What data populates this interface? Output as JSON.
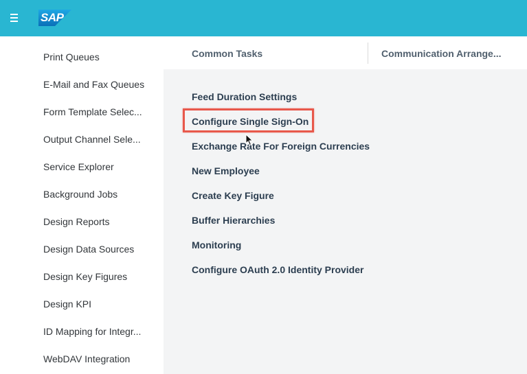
{
  "header": {
    "menu_icon": "hamburger-menu-icon",
    "logo_text": "SAP",
    "brand_color": "#29b6d2"
  },
  "sidebar": {
    "items": [
      {
        "label": "Print Queues"
      },
      {
        "label": "E-Mail and Fax Queues"
      },
      {
        "label": "Form Template Selec..."
      },
      {
        "label": "Output Channel Sele..."
      },
      {
        "label": "Service Explorer"
      },
      {
        "label": "Background Jobs"
      },
      {
        "label": "Design Reports"
      },
      {
        "label": "Design Data Sources"
      },
      {
        "label": "Design Key Figures"
      },
      {
        "label": "Design KPI"
      },
      {
        "label": "ID Mapping for Integr..."
      },
      {
        "label": "WebDAV Integration"
      }
    ]
  },
  "tabs": [
    {
      "label": "Common Tasks"
    },
    {
      "label": "Communication Arrange..."
    }
  ],
  "tasks": [
    {
      "label": "Feed Duration Settings"
    },
    {
      "label": "Configure Single Sign-On",
      "highlighted": true
    },
    {
      "label": "Exchange Rate For Foreign Currencies"
    },
    {
      "label": "New Employee"
    },
    {
      "label": "Create Key Figure"
    },
    {
      "label": "Buffer Hierarchies"
    },
    {
      "label": "Monitoring"
    },
    {
      "label": "Configure OAuth 2.0 Identity Provider"
    }
  ],
  "highlight_color": "#e8584b",
  "cursor_icon": "mouse-pointer-icon"
}
